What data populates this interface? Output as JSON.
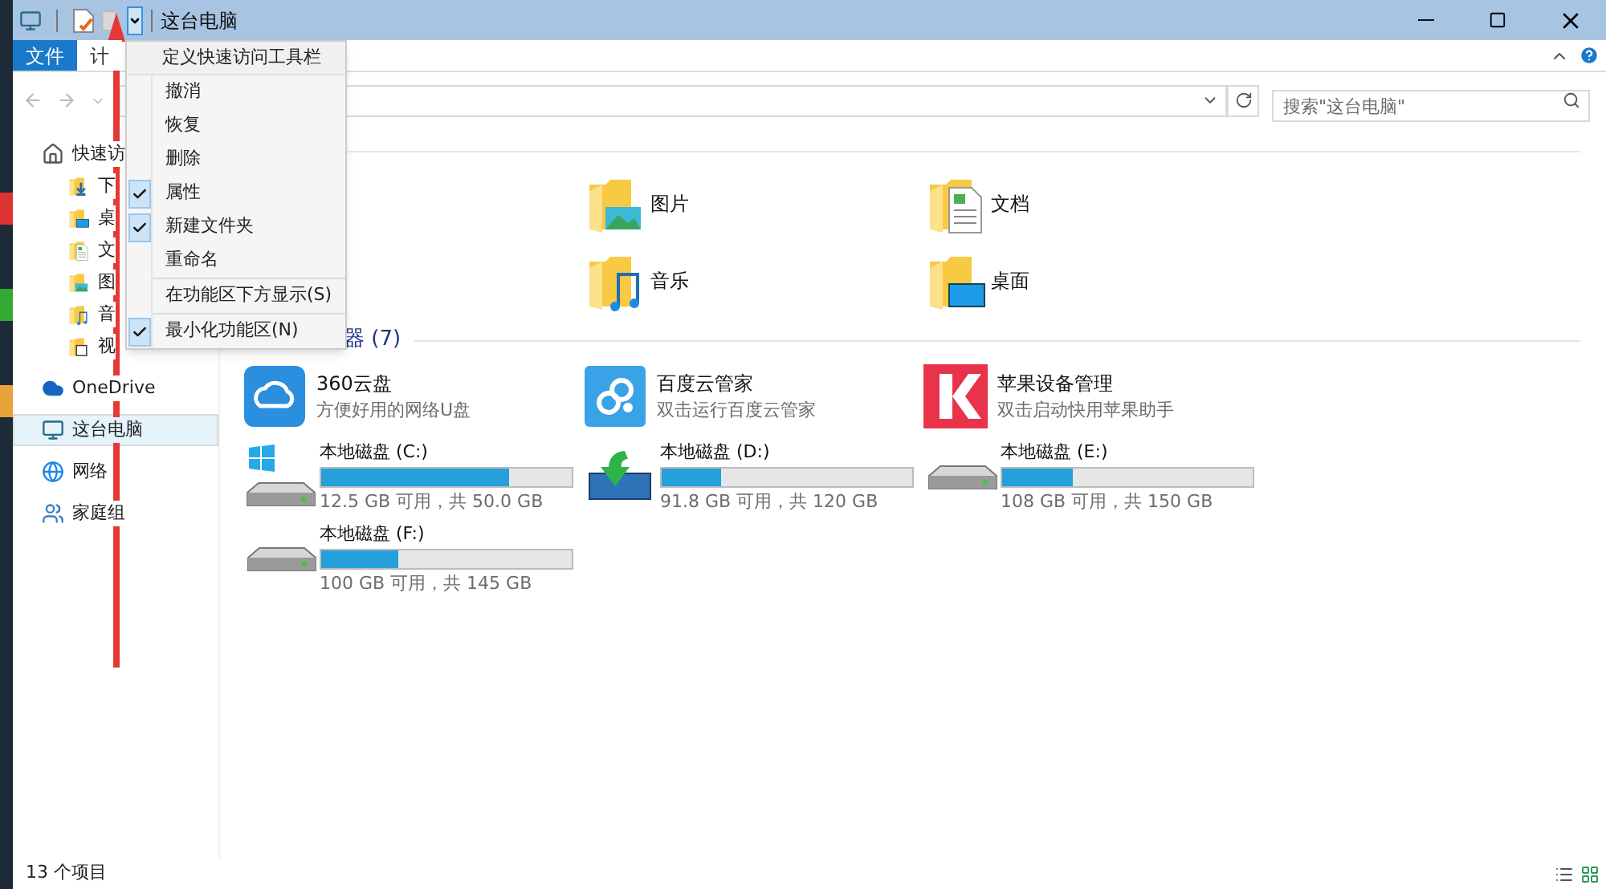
{
  "window": {
    "title": "这台电脑"
  },
  "ribbon_tabs": [
    {
      "label": "文件",
      "selected": true
    },
    {
      "label": "计",
      "selected": false
    }
  ],
  "quick_access_menu": {
    "title": "定义快速访问工具栏",
    "groups": [
      [
        {
          "label": "撤消",
          "checked": false
        },
        {
          "label": "恢复",
          "checked": false
        },
        {
          "label": "删除",
          "checked": false
        },
        {
          "label": "属性",
          "checked": true
        },
        {
          "label": "新建文件夹",
          "checked": true
        },
        {
          "label": "重命名",
          "checked": false
        }
      ],
      [
        {
          "label": "在功能区下方显示(S)",
          "checked": false
        }
      ],
      [
        {
          "label": "最小化功能区(N)",
          "checked": true
        }
      ]
    ]
  },
  "search": {
    "placeholder": "搜索\"这台电脑\""
  },
  "sidebar": {
    "items": [
      {
        "label": "快速访",
        "kind": "quick",
        "selected": false,
        "children": [
          {
            "label": "下",
            "kind": "download",
            "selected": false
          },
          {
            "label": "桌",
            "kind": "desktop",
            "selected": false
          },
          {
            "label": "文",
            "kind": "documents",
            "selected": false
          },
          {
            "label": "图",
            "kind": "pictures",
            "selected": false
          },
          {
            "label": "音",
            "kind": "music",
            "selected": false
          },
          {
            "label": "视",
            "kind": "videos",
            "selected": false
          }
        ]
      },
      {
        "label": "OneDrive",
        "kind": "onedrive",
        "selected": false
      },
      {
        "label": "这台电脑",
        "kind": "pc",
        "selected": true
      },
      {
        "label": "网络",
        "kind": "network",
        "selected": false
      },
      {
        "label": "家庭组",
        "kind": "homegroup",
        "selected": false
      }
    ]
  },
  "folders": [
    {
      "label": "图片",
      "kind": "pictures"
    },
    {
      "label": "文档",
      "kind": "documents"
    },
    {
      "label": "音乐",
      "kind": "music"
    },
    {
      "label": "桌面",
      "kind": "desktop"
    }
  ],
  "devices_header": "器 (7)",
  "apps": [
    {
      "name": "360云盘",
      "subtitle": "方便好用的网络U盘",
      "kind": "cloud360"
    },
    {
      "name": "百度云管家",
      "subtitle": "双击运行百度云管家",
      "kind": "baidu"
    },
    {
      "name": "苹果设备管理",
      "subtitle": "双击启动快用苹果助手",
      "kind": "k"
    }
  ],
  "drives": [
    {
      "name": "本地磁盘 (C:)",
      "level": 0.75,
      "reading": "12.5 GB 可用，共 50.0 GB",
      "kind": "system"
    },
    {
      "name": "本地磁盘 (D:)",
      "level": 0.235,
      "reading": "91.8 GB 可用，共 120 GB",
      "kind": "install"
    },
    {
      "name": "本地磁盘 (E:)",
      "level": 0.28,
      "reading": "108 GB 可用，共 150 GB",
      "kind": "disk"
    },
    {
      "name": "本地磁盘 (F:)",
      "level": 0.31,
      "reading": "100 GB 可用，共 145 GB",
      "kind": "disk"
    }
  ],
  "status_bar": {
    "count": "13 个项目"
  }
}
